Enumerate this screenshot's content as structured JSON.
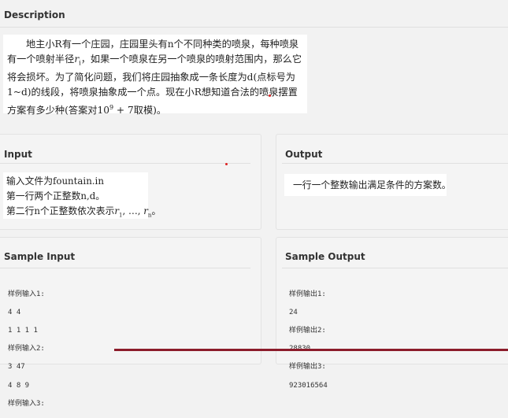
{
  "description": {
    "title": "Description",
    "text_prefix": "地主小R有一个庄园，庄园里头有n个不同种类的喷泉，每种喷泉有一个喷射半径",
    "var_r": "r",
    "var_r_sub": "i",
    "text_middle": "，如果一个喷泉在另一个喷泉的喷射范围内，那么它将会损坏。为了简化问题，我们将庄园抽象成一条长度为d(点标号为1~d)的线段，将喷泉抽象成一个点。现在小R想知道合法的喷泉摆置方案有多少种(答案对",
    "mod_base": "10",
    "mod_exp": "9",
    "mod_tail": " + 7取模)。"
  },
  "input": {
    "title": "Input",
    "line1": "输入文件为fountain.in",
    "line2": "第一行两个正整数n,d。",
    "line3_prefix": "第二行n个正整数依次表示",
    "r1": "r",
    "r1_sub": "1",
    "dots": ", …, ",
    "rn": "r",
    "rn_sub": "n",
    "line3_suffix": "。"
  },
  "output": {
    "title": "Output",
    "text": "一行一个整数输出满足条件的方案数。"
  },
  "sample_input": {
    "title": "Sample Input",
    "lines": [
      "样例输入1:",
      "4 4",
      "1 1 1 1",
      "样例输入2:",
      "3 47",
      "4 8 9",
      "样例输入3:"
    ]
  },
  "sample_output": {
    "title": "Sample Output",
    "lines": [
      "样例输出1:",
      "24",
      "样例输出2:",
      "28830",
      "样例输出3:",
      "923016564"
    ]
  }
}
